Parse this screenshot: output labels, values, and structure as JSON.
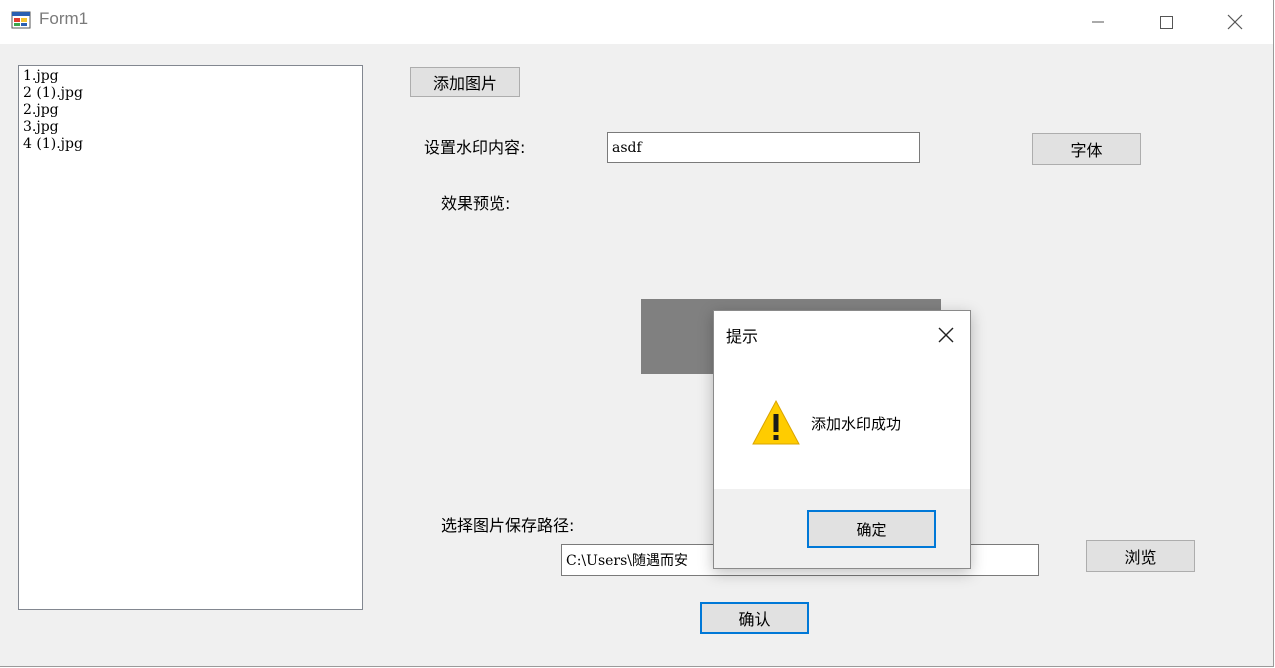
{
  "window": {
    "title": "Form1",
    "icon": "winforms-app-icon",
    "controls": {
      "minimize": "minimize-icon",
      "maximize": "maximize-icon",
      "close": "close-icon"
    }
  },
  "file_list": {
    "items": [
      "1.jpg",
      "2 (1).jpg",
      "2.jpg",
      "3.jpg",
      "4 (1).jpg"
    ]
  },
  "form": {
    "add_image_button": "添加图片",
    "watermark_label": "设置水印内容:",
    "watermark_value": "asdf",
    "font_button": "字体",
    "preview_label": "效果预览:",
    "save_path_label": "选择图片保存路径:",
    "save_path_value": "C:\\Users\\随遇而安",
    "browse_button": "浏览",
    "confirm_button": "确认"
  },
  "dialog": {
    "title": "提示",
    "message": "添加水印成功",
    "ok_button": "确定",
    "icon": "warning-icon",
    "accent_color": "#0078d7",
    "warning_color": "#ffcc00"
  }
}
